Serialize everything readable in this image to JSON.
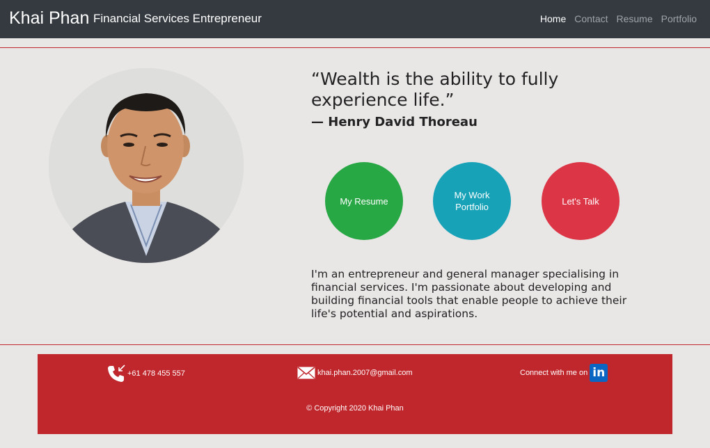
{
  "header": {
    "brand": "Khai Phan",
    "tagline": "Financial Services Entrepreneur",
    "nav": [
      {
        "label": "Home",
        "active": true
      },
      {
        "label": "Contact",
        "active": false
      },
      {
        "label": "Resume",
        "active": false
      },
      {
        "label": "Portfolio",
        "active": false
      }
    ]
  },
  "hero": {
    "quote": "“Wealth is the ability to fully experience life.”",
    "author": "— Henry David Thoreau",
    "buttons": [
      {
        "label": "My Resume",
        "color": "#28a745"
      },
      {
        "label": "My Work Portfolio",
        "color": "#17a2b8"
      },
      {
        "label": "Let's Talk",
        "color": "#dc3545"
      }
    ],
    "intro": "I'm an entrepreneur and general manager specialising in financial services. I'm passionate about developing and building financial tools that enable people to achieve their life's potential and aspirations."
  },
  "footer": {
    "phone": "+61 478 455 557",
    "email": "khai.phan.2007@gmail.com",
    "social_label": "Connect with me on",
    "social_icon": "linkedin-icon",
    "copyright": "© Copyright 2020 Khai Phan"
  },
  "colors": {
    "navbar": "#343a40",
    "accent": "#c0272d",
    "background": "#e9e6e6"
  }
}
